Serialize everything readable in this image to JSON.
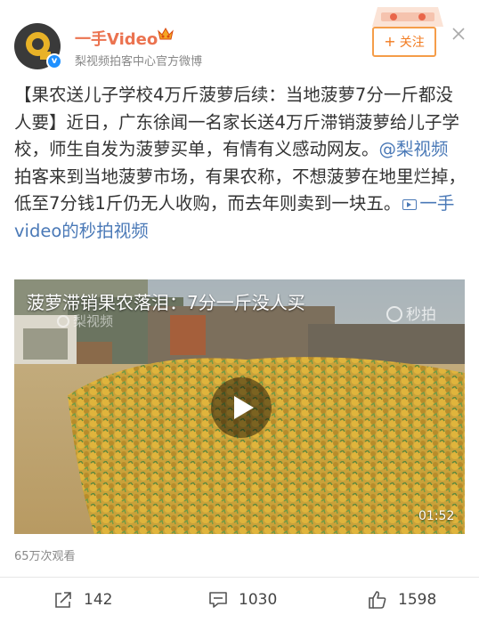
{
  "header": {
    "username": "一手Video",
    "source": "梨视频拍客中心官方微博",
    "follow_label": "关注",
    "follow_plus": "+"
  },
  "post": {
    "text_before_mention": "【果农送儿子学校4万斤菠萝后续：当地菠萝7分一斤都没人要】近日，广东徐闻一名家长送4万斤滞销菠萝给儿子学校，师生自发为菠萝买单，有情有义感动网友。",
    "mention": "@梨视频",
    "text_after_mention": " 拍客来到当地菠萝市场，有果农称，不想菠萝在地里烂掉，低至7分钱1斤仍无人收购，而去年则卖到一块五。",
    "video_link": "一手video的秒拍视频"
  },
  "video": {
    "title": "菠萝滞销果农落泪：7分一斤没人买",
    "watermark_left": "梨视频",
    "watermark_right": "秒拍",
    "duration": "01:52"
  },
  "stats": {
    "views": "65万次观看",
    "shares": "142",
    "comments": "1030",
    "likes": "1598"
  },
  "colors": {
    "username": "#eb7350",
    "link": "#4a79b7",
    "follow": "#f27b20"
  }
}
